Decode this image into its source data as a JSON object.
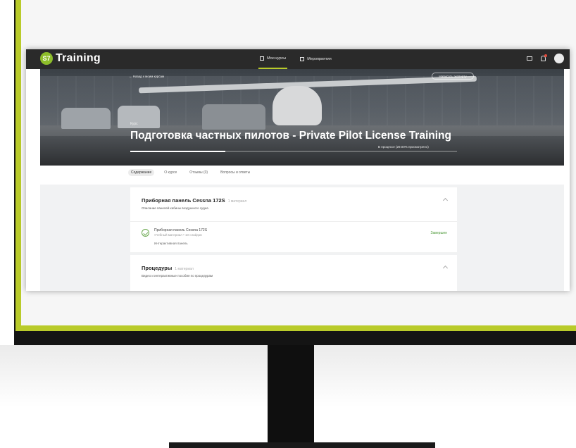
{
  "app": {
    "logo_mark": "S7",
    "logo_text": "Training",
    "nav": [
      {
        "label": "Мои курсы",
        "active": true
      },
      {
        "label": "Мероприятия",
        "active": false
      }
    ]
  },
  "hero": {
    "back_link": "← Назад к моим курсам",
    "expert_button": "Написать эксперту",
    "breadcrumb": "Курс",
    "title": "Подготовка частных пилотов - Private Pilot License Training",
    "progress_text": "В процессе (29.00% просмотрено)",
    "progress_percent": 29
  },
  "tabs": [
    {
      "label": "Содержание",
      "active": true
    },
    {
      "label": "О курсе",
      "active": false
    },
    {
      "label": "Отзывы (0)",
      "active": false
    },
    {
      "label": "Вопросы и ответы",
      "active": false
    }
  ],
  "sections": [
    {
      "title": "Приборная панель Cessna 172S",
      "count": "1 материал",
      "description": "Описание панелей кабины воздушного судна",
      "item": {
        "title": "Приборная панель Cessna 172S",
        "meta": "Учебный материал • 10 слайдов",
        "type": "Интерактивная панель",
        "status": "Завершен"
      }
    },
    {
      "title": "Процедуры",
      "count": "1 материал",
      "description": "Видео и интерактивные пособия по процедурам"
    }
  ],
  "colors": {
    "accent": "#b9cb2a",
    "brand_green": "#8dbd2a",
    "status_green": "#4e9a3a",
    "topbar": "#2a2a2a"
  }
}
